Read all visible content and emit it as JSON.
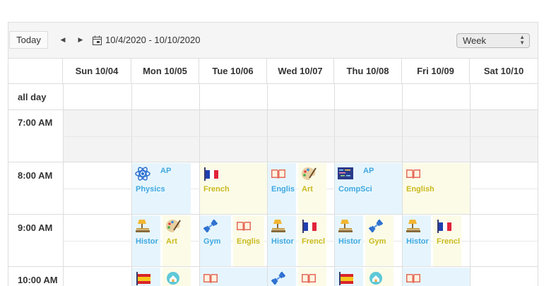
{
  "toolbar": {
    "today_label": "Today",
    "prev_icon": "triangle-left-icon",
    "next_icon": "triangle-right-icon",
    "calendar_icon": "calendar-icon",
    "date_range": "10/4/2020 - 10/10/2020",
    "view_selected": "Week"
  },
  "columns": [
    "Sun 10/04",
    "Mon 10/05",
    "Tue 10/06",
    "Wed 10/07",
    "Thu 10/08",
    "Fri 10/09",
    "Sat 10/10"
  ],
  "all_day_label": "all day",
  "time_labels": [
    "7:00 AM",
    "8:00 AM",
    "9:00 AM",
    "10:00 AM"
  ],
  "events": [
    {
      "day": "Mon 10/05",
      "time": "8:00 AM",
      "title": "AP Physics",
      "title_a": "AP",
      "title_b": "Physics",
      "icon": "atom-icon",
      "color": "blue"
    },
    {
      "day": "Tue 10/06",
      "time": "8:00 AM",
      "title": "French",
      "icon": "french-flag-icon",
      "color": "yellow"
    },
    {
      "day": "Wed 10/07",
      "time": "8:00 AM",
      "title": "Englis",
      "icon": "open-book-icon",
      "color": "blue"
    },
    {
      "day": "Wed 10/07",
      "time": "8:00 AM",
      "title": "Art",
      "icon": "palette-icon",
      "color": "yellow"
    },
    {
      "day": "Thu 10/08",
      "time": "8:00 AM",
      "title": "AP CompSci",
      "title_a": "AP",
      "title_b": "CompSci",
      "icon": "code-screen-icon",
      "color": "blue"
    },
    {
      "day": "Fri 10/09",
      "time": "8:00 AM",
      "title": "English",
      "icon": "open-book-icon",
      "color": "yellow"
    },
    {
      "day": "Mon 10/05",
      "time": "9:00 AM",
      "title": "Histor",
      "icon": "lamp-books-icon",
      "color": "blue"
    },
    {
      "day": "Mon 10/05",
      "time": "9:00 AM",
      "title": "Art",
      "icon": "palette-icon",
      "color": "yellow"
    },
    {
      "day": "Tue 10/06",
      "time": "9:00 AM",
      "title": "Gym",
      "icon": "dumbbell-icon",
      "color": "blue"
    },
    {
      "day": "Tue 10/06",
      "time": "9:00 AM",
      "title": "Englis",
      "icon": "open-book-icon",
      "color": "yellow"
    },
    {
      "day": "Wed 10/07",
      "time": "9:00 AM",
      "title": "Histor",
      "icon": "lamp-books-icon",
      "color": "blue"
    },
    {
      "day": "Wed 10/07",
      "time": "9:00 AM",
      "title": "Frencl",
      "icon": "french-flag-icon",
      "color": "yellow"
    },
    {
      "day": "Thu 10/08",
      "time": "9:00 AM",
      "title": "Histor",
      "icon": "lamp-books-icon",
      "color": "blue"
    },
    {
      "day": "Thu 10/08",
      "time": "9:00 AM",
      "title": "Gym",
      "icon": "dumbbell-icon",
      "color": "yellow"
    },
    {
      "day": "Fri 10/09",
      "time": "9:00 AM",
      "title": "Histor",
      "icon": "lamp-books-icon",
      "color": "blue"
    },
    {
      "day": "Fri 10/09",
      "time": "9:00 AM",
      "title": "Frencl",
      "icon": "french-flag-icon",
      "color": "yellow"
    },
    {
      "day": "Mon 10/05",
      "time": "10:00 AM",
      "title": "",
      "icon": "spanish-flag-icon",
      "color": "blue"
    },
    {
      "day": "Mon 10/05",
      "time": "10:00 AM",
      "title": "",
      "icon": "home-globe-icon",
      "color": "yellow"
    },
    {
      "day": "Tue 10/06",
      "time": "10:00 AM",
      "title": "",
      "icon": "open-book-icon",
      "color": "blue"
    },
    {
      "day": "Wed 10/07",
      "time": "10:00 AM",
      "title": "",
      "icon": "dumbbell-icon",
      "color": "blue"
    },
    {
      "day": "Wed 10/07",
      "time": "10:00 AM",
      "title": "",
      "icon": "open-book-icon",
      "color": "yellow"
    },
    {
      "day": "Thu 10/08",
      "time": "10:00 AM",
      "title": "",
      "icon": "spanish-flag-icon",
      "color": "blue"
    },
    {
      "day": "Thu 10/08",
      "time": "10:00 AM",
      "title": "",
      "icon": "home-globe-icon",
      "color": "yellow"
    },
    {
      "day": "Fri 10/09",
      "time": "10:00 AM",
      "title": "",
      "icon": "open-book-icon",
      "color": "blue"
    }
  ],
  "colors": {
    "event_blue": "#e6f5fd",
    "event_yellow": "#fcfbe8",
    "title_blue": "#3fa8e0",
    "title_yellow": "#c9b91e",
    "grid": "#dddddd"
  }
}
